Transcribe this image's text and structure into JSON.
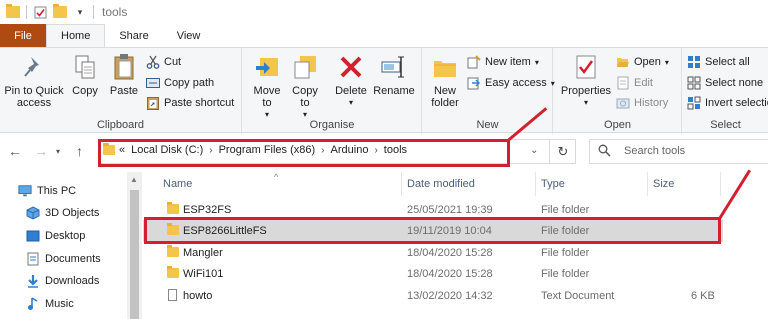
{
  "window": {
    "title": "tools"
  },
  "tabs": [
    {
      "label": "File"
    },
    {
      "label": "Home"
    },
    {
      "label": "Share"
    },
    {
      "label": "View"
    }
  ],
  "ribbon": {
    "clipboard": {
      "label": "Clipboard",
      "pin": "Pin to Quick access",
      "copy": "Copy",
      "paste": "Paste",
      "cut": "Cut",
      "copy_path": "Copy path",
      "paste_shortcut": "Paste shortcut"
    },
    "organise": {
      "label": "Organise",
      "move_to": "Move to",
      "copy_to": "Copy to",
      "delete": "Delete",
      "rename": "Rename"
    },
    "new": {
      "label": "New",
      "new_folder": "New folder",
      "new_item": "New item",
      "easy_access": "Easy access"
    },
    "open": {
      "label": "Open",
      "properties": "Properties",
      "open": "Open",
      "edit": "Edit",
      "history": "History"
    },
    "select": {
      "label": "Select",
      "select_all": "Select all",
      "select_none": "Select none",
      "invert": "Invert selection"
    }
  },
  "address": {
    "overflow": "«",
    "crumbs": [
      "Local Disk (C:)",
      "Program Files (x86)",
      "Arduino",
      "tools"
    ],
    "search_placeholder": "Search tools"
  },
  "navpane": {
    "items": [
      {
        "label": "This PC",
        "icon": "monitor-icon"
      },
      {
        "label": "3D Objects",
        "icon": "cube-icon"
      },
      {
        "label": "Desktop",
        "icon": "desktop-icon"
      },
      {
        "label": "Documents",
        "icon": "documents-icon"
      },
      {
        "label": "Downloads",
        "icon": "download-icon"
      },
      {
        "label": "Music",
        "icon": "music-icon"
      }
    ]
  },
  "filelist": {
    "columns": {
      "name": "Name",
      "date": "Date modified",
      "type": "Type",
      "size": "Size"
    },
    "rows": [
      {
        "name": "ESP32FS",
        "date": "25/05/2021 19:39",
        "type": "File folder",
        "size": "",
        "kind": "folder"
      },
      {
        "name": "ESP8266LittleFS",
        "date": "19/11/2019 10:04",
        "type": "File folder",
        "size": "",
        "kind": "folder"
      },
      {
        "name": "Mangler",
        "date": "18/04/2020 15:28",
        "type": "File folder",
        "size": "",
        "kind": "folder"
      },
      {
        "name": "WiFi101",
        "date": "18/04/2020 15:28",
        "type": "File folder",
        "size": "",
        "kind": "folder"
      },
      {
        "name": "howto",
        "date": "13/02/2020 14:32",
        "type": "Text Document",
        "size": "6 KB",
        "kind": "file"
      }
    ]
  },
  "colors": {
    "annotation_red": "#d3202e",
    "file_tab": "#b14a10",
    "folder": "#f3c54a"
  }
}
